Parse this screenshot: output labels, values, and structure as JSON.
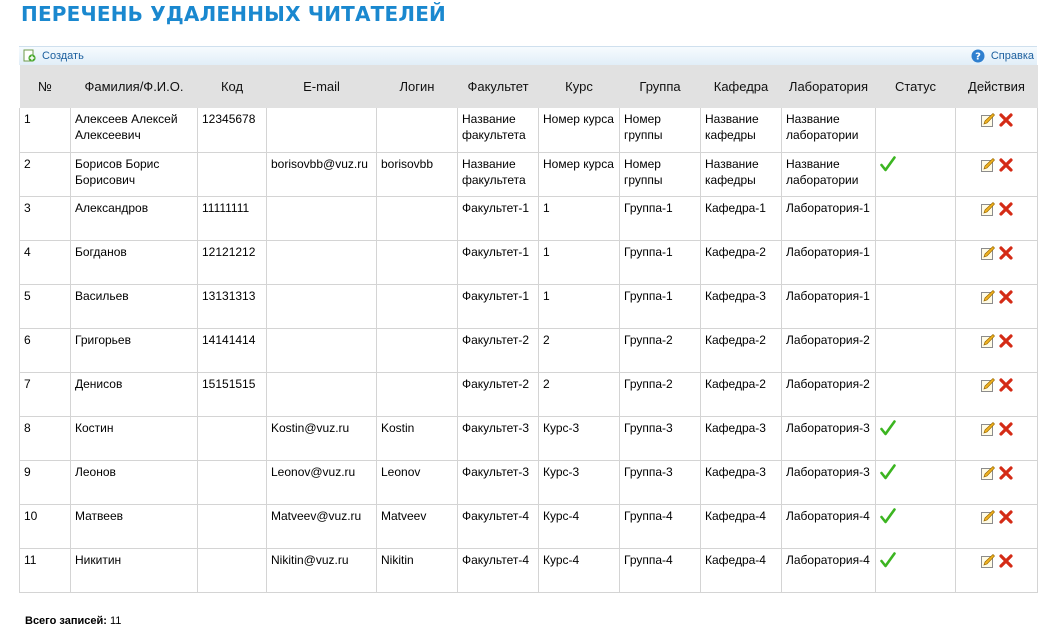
{
  "page": {
    "title": "ПЕРЕЧЕНЬ УДАЛЕННЫХ ЧИТАТЕЛЕЙ"
  },
  "toolbar": {
    "create_label": "Создать",
    "create_icon": "add-icon",
    "help_label": "Справка",
    "help_icon": "help-icon"
  },
  "colors": {
    "title": "#1a88cf",
    "header_bg": "#e1e1e1",
    "check": "#3cb521",
    "delete": "#d42b16"
  },
  "table": {
    "headers": [
      "№",
      "Фамилия/Ф.И.О.",
      "Код",
      "E-mail",
      "Логин",
      "Факультет",
      "Курс",
      "Группа",
      "Кафедра",
      "Лаборатория",
      "Статус",
      "Действия"
    ],
    "rows": [
      {
        "num": "1",
        "name": "Алексеев Алексей Алексеевич",
        "code": "12345678",
        "email": "",
        "login": "",
        "faculty": "Название факультета",
        "course": "Номер курса",
        "group": "Номер группы",
        "department": "Название кафедры",
        "lab": "Название лаборатории",
        "status": false
      },
      {
        "num": "2",
        "name": "Борисов Борис Борисович",
        "code": "",
        "email": "borisovbb@vuz.ru",
        "login": "borisovbb",
        "faculty": "Название факультета",
        "course": "Номер курса",
        "group": "Номер группы",
        "department": "Название кафедры",
        "lab": "Название лаборатории",
        "status": true
      },
      {
        "num": "3",
        "name": "Александров",
        "code": "11111111",
        "email": "",
        "login": "",
        "faculty": "Факультет-1",
        "course": "1",
        "group": "Группа-1",
        "department": "Кафедра-1",
        "lab": "Лаборатория-1",
        "status": false
      },
      {
        "num": "4",
        "name": "Богданов",
        "code": "12121212",
        "email": "",
        "login": "",
        "faculty": "Факультет-1",
        "course": "1",
        "group": "Группа-1",
        "department": "Кафедра-2",
        "lab": "Лаборатория-1",
        "status": false
      },
      {
        "num": "5",
        "name": "Васильев",
        "code": "13131313",
        "email": "",
        "login": "",
        "faculty": "Факультет-1",
        "course": "1",
        "group": "Группа-1",
        "department": "Кафедра-3",
        "lab": "Лаборатория-1",
        "status": false
      },
      {
        "num": "6",
        "name": "Григорьев",
        "code": "14141414",
        "email": "",
        "login": "",
        "faculty": "Факультет-2",
        "course": "2",
        "group": "Группа-2",
        "department": "Кафедра-2",
        "lab": "Лаборатория-2",
        "status": false
      },
      {
        "num": "7",
        "name": "Денисов",
        "code": "15151515",
        "email": "",
        "login": "",
        "faculty": "Факультет-2",
        "course": "2",
        "group": "Группа-2",
        "department": "Кафедра-2",
        "lab": "Лаборатория-2",
        "status": false
      },
      {
        "num": "8",
        "name": "Костин",
        "code": "",
        "email": "Kostin@vuz.ru",
        "login": "Kostin",
        "faculty": "Факультет-3",
        "course": "Курс-3",
        "group": "Группа-3",
        "department": "Кафедра-3",
        "lab": "Лаборатория-3",
        "status": true
      },
      {
        "num": "9",
        "name": "Леонов",
        "code": "",
        "email": "Leonov@vuz.ru",
        "login": "Leonov",
        "faculty": "Факультет-3",
        "course": "Курс-3",
        "group": "Группа-3",
        "department": "Кафедра-3",
        "lab": "Лаборатория-3",
        "status": true
      },
      {
        "num": "10",
        "name": "Матвеев",
        "code": "",
        "email": "Matveev@vuz.ru",
        "login": "Matveev",
        "faculty": "Факультет-4",
        "course": "Курс-4",
        "group": "Группа-4",
        "department": "Кафедра-4",
        "lab": "Лаборатория-4",
        "status": true
      },
      {
        "num": "11",
        "name": "Никитин",
        "code": "",
        "email": "Nikitin@vuz.ru",
        "login": "Nikitin",
        "faculty": "Факультет-4",
        "course": "Курс-4",
        "group": "Группа-4",
        "department": "Кафедра-4",
        "lab": "Лаборатория-4",
        "status": true
      }
    ],
    "action_icons": [
      "edit-icon",
      "delete-icon"
    ]
  },
  "footer": {
    "total_label": "Всего записей:",
    "total_value": "11"
  }
}
